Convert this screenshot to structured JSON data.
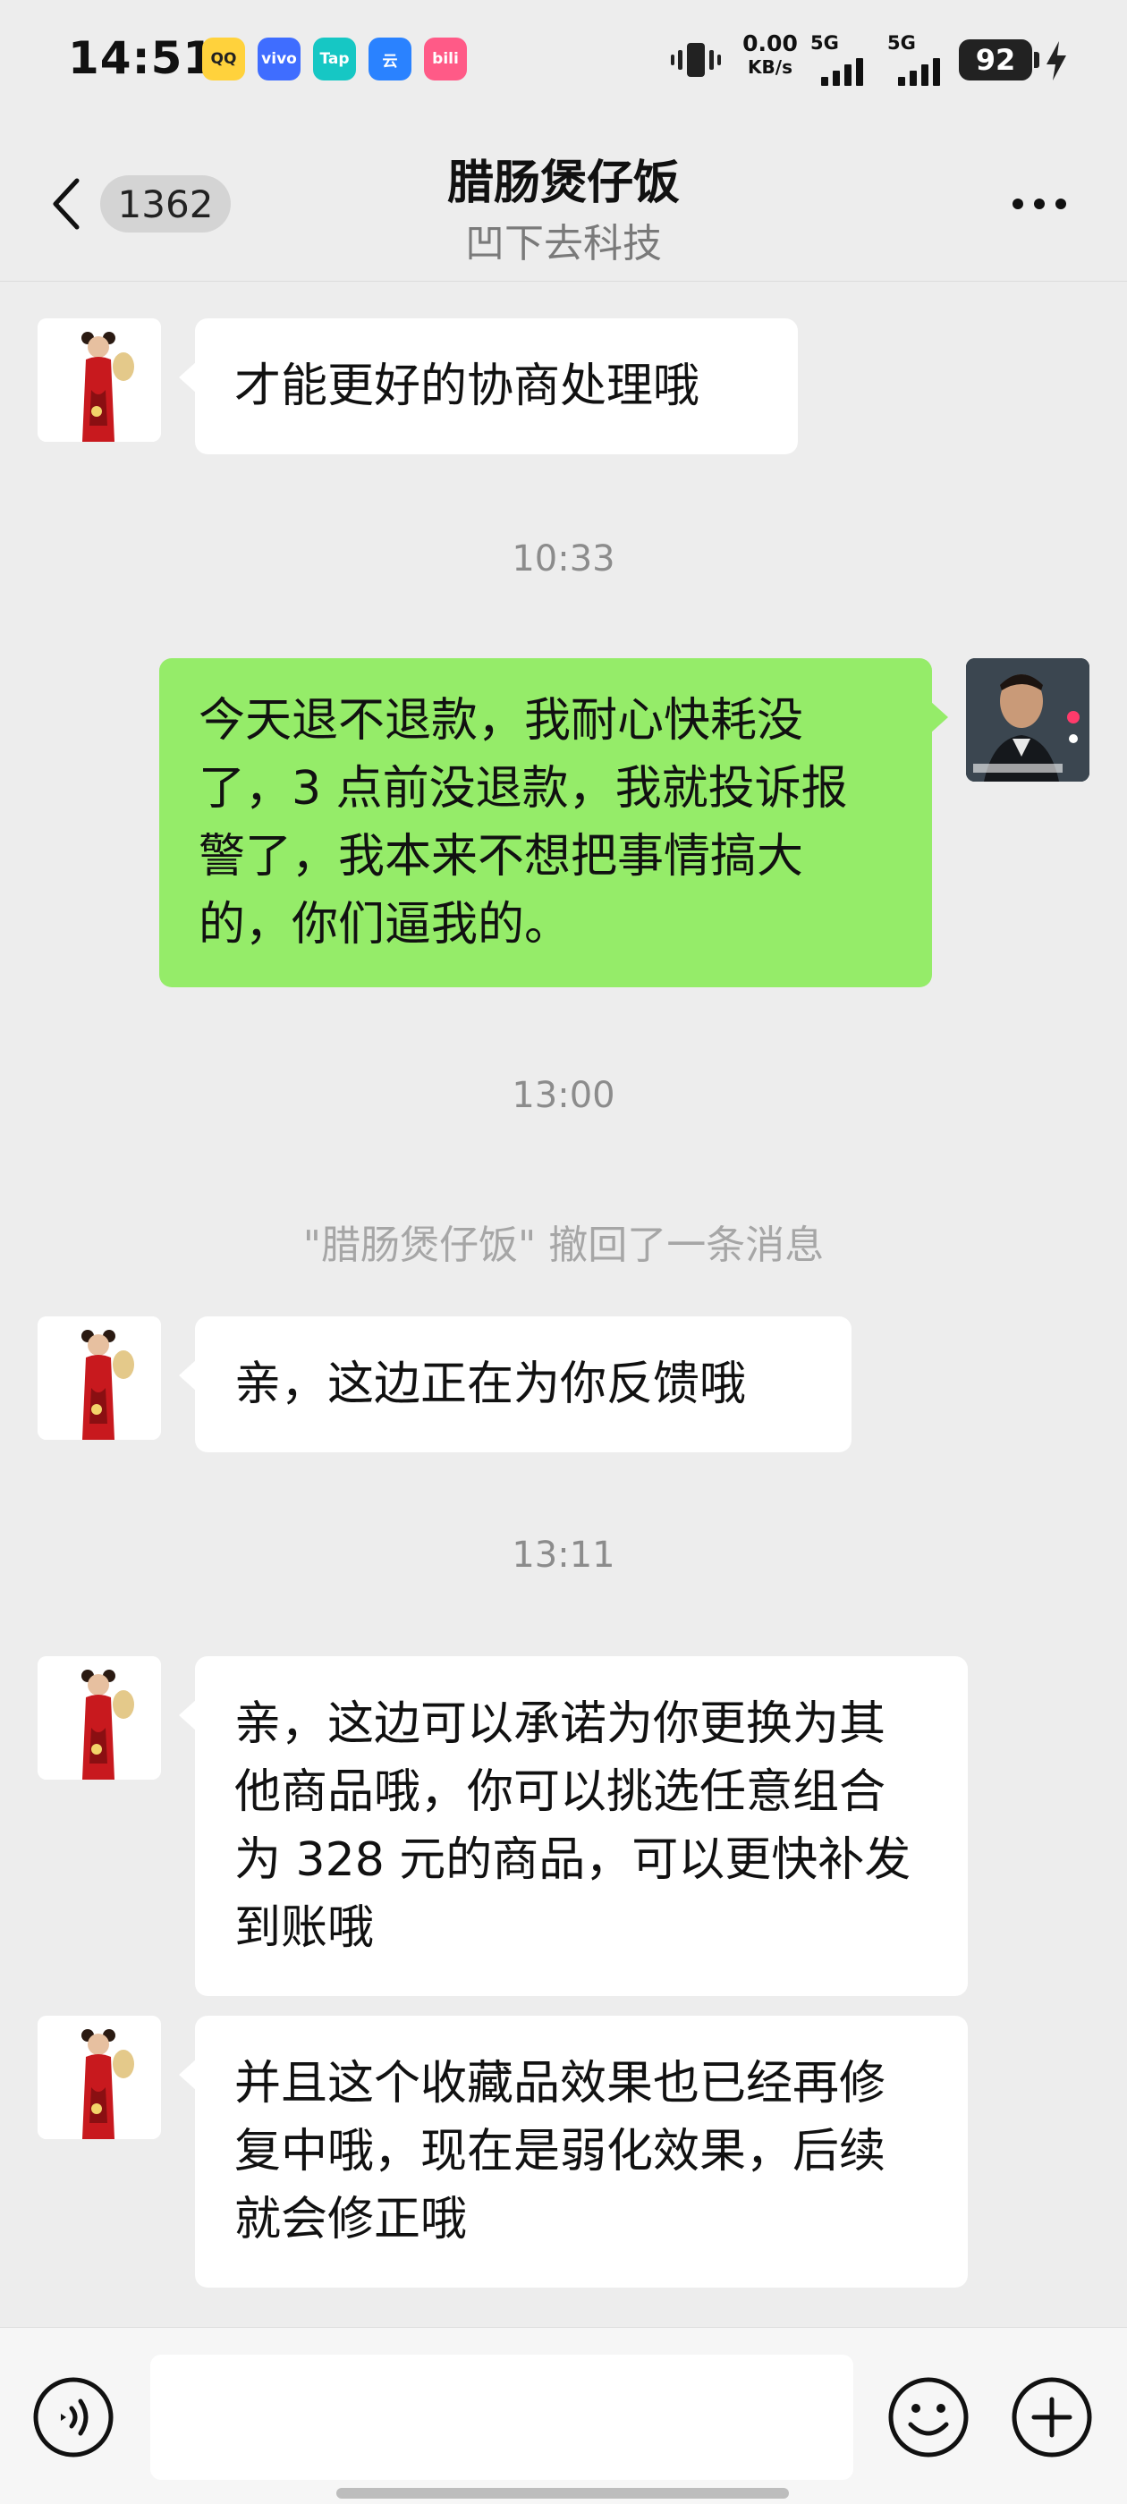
{
  "status_bar": {
    "time": "14:51",
    "app_icons": [
      {
        "name": "qq-icon",
        "label": "QQ"
      },
      {
        "name": "vivo-icon",
        "label": "vivo"
      },
      {
        "name": "taptap-icon",
        "label": "Tap"
      },
      {
        "name": "baidu-icon",
        "label": "云"
      },
      {
        "name": "bilibili-icon",
        "label": "bili"
      }
    ],
    "net_speed_value": "0.00",
    "net_speed_unit": "KB/s",
    "signal1_label": "5G",
    "signal2_label": "5G",
    "battery": "92"
  },
  "nav": {
    "unread_count": "1362",
    "title": "腊肠煲仔饭",
    "subtitle": "凹下去科技"
  },
  "messages": [
    {
      "side": "left",
      "text": "才能更好的协商处理哦"
    },
    {
      "type": "time",
      "text": "10:33"
    },
    {
      "side": "right",
      "text": "今天退不退款，我耐心快耗没了，3 点前没退款，我就投诉报警了，我本来不想把事情搞大的，你们逼我的。"
    },
    {
      "type": "time",
      "text": "13:00"
    },
    {
      "type": "system",
      "text": "\"腊肠煲仔饭\" 撤回了一条消息"
    },
    {
      "side": "left",
      "text": "亲，这边正在为你反馈哦"
    },
    {
      "type": "time",
      "text": "13:11"
    },
    {
      "side": "left",
      "text": "亲，这边可以承诺为你更换为其他商品哦，你可以挑选任意组合为 328 元的商品，可以更快补发到账哦"
    },
    {
      "side": "left",
      "text": "并且这个收藏品效果也已经再修复中哦，现在是弱化效果，后续就会修正哦"
    }
  ],
  "input": {
    "value": "",
    "placeholder": ""
  },
  "colors": {
    "background": "#ededed",
    "bubble_self": "#95ec69",
    "bubble_other": "#ffffff"
  }
}
